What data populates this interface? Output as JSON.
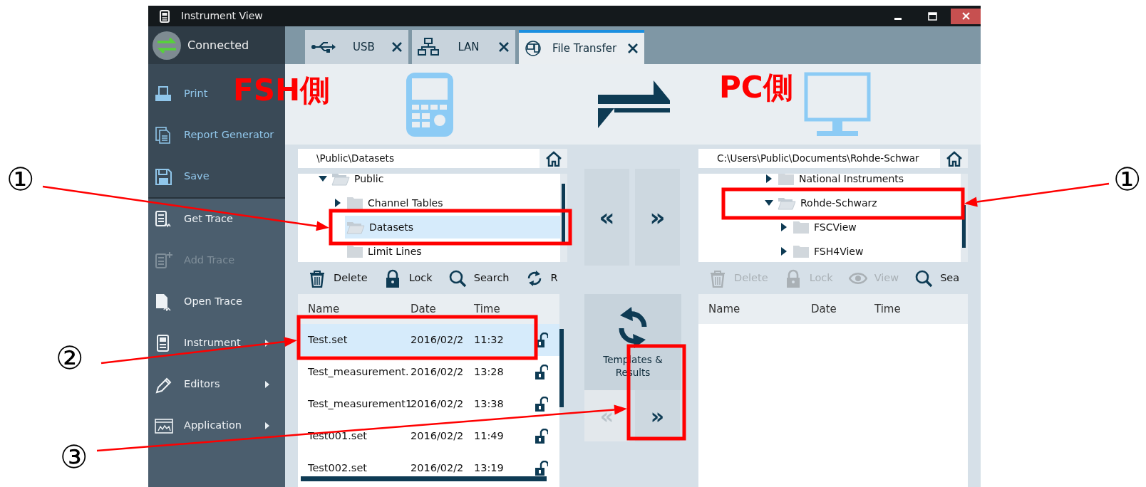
{
  "window": {
    "title": "Instrument View"
  },
  "sidebar": {
    "status": "Connected",
    "sections": [
      {
        "kind": "output",
        "items": [
          {
            "label": "Print",
            "disabled": false,
            "submenu": false
          },
          {
            "label": "Report Generator",
            "disabled": false,
            "submenu": false
          },
          {
            "label": "Save",
            "disabled": false,
            "submenu": false
          }
        ]
      },
      {
        "kind": "trace",
        "items": [
          {
            "label": "Get Trace",
            "disabled": false,
            "submenu": false
          },
          {
            "label": "Add Trace",
            "disabled": true,
            "submenu": false
          },
          {
            "label": "Open Trace",
            "disabled": false,
            "submenu": false
          },
          {
            "label": "Instrument",
            "disabled": false,
            "submenu": true
          },
          {
            "label": "Editors",
            "disabled": false,
            "submenu": true
          },
          {
            "label": "Application",
            "disabled": false,
            "submenu": true
          }
        ]
      }
    ]
  },
  "tabs": [
    {
      "label": "USB",
      "selected": false
    },
    {
      "label": "LAN",
      "selected": false
    },
    {
      "label": "File Transfer",
      "selected": true
    }
  ],
  "panels": [
    {
      "path": "\\Public\\Datasets",
      "tree": [
        {
          "label": "Public",
          "expanded": true,
          "selected": false,
          "children": [
            {
              "label": "Channel Tables",
              "expanded": false,
              "selected": false
            },
            {
              "label": "Datasets",
              "selected": true
            },
            {
              "label": "Limit Lines",
              "selected": false
            }
          ]
        }
      ],
      "toolbar": [
        {
          "label": "Delete",
          "disabled": false
        },
        {
          "label": "Lock",
          "disabled": false
        },
        {
          "label": "Search",
          "disabled": false
        },
        {
          "label": "R",
          "disabled": false
        }
      ],
      "columns": [
        "Name",
        "Date",
        "Time"
      ],
      "rows": [
        {
          "name": "Test.set",
          "date": "2016/02/2",
          "time": "11:32",
          "locked": false,
          "selected": true
        },
        {
          "name": "Test_measurement.",
          "date": "2016/02/2",
          "time": "13:28",
          "locked": false,
          "selected": false
        },
        {
          "name": "Test_measurement1",
          "date": "2016/02/2",
          "time": "13:38",
          "locked": false,
          "selected": false
        },
        {
          "name": "Test001.set",
          "date": "2016/02/2",
          "time": "11:49",
          "locked": false,
          "selected": false
        },
        {
          "name": "Test002.set",
          "date": "2016/02/2",
          "time": "13:19",
          "locked": false,
          "selected": false
        }
      ]
    },
    {
      "path": "C:\\Users\\Public\\Documents\\Rohde-Schwar",
      "tree": [
        {
          "label": "National Instruments",
          "expanded": false,
          "selected": false
        },
        {
          "label": "Rohde-Schwarz",
          "expanded": true,
          "selected": false,
          "children": [
            {
              "label": "FSCView",
              "expanded": false,
              "selected": false
            },
            {
              "label": "FSH4View",
              "expanded": false,
              "selected": false
            }
          ]
        }
      ],
      "toolbar": [
        {
          "label": "Delete",
          "disabled": true
        },
        {
          "label": "Lock",
          "disabled": true
        },
        {
          "label": "View",
          "disabled": true
        },
        {
          "label": "Sea",
          "disabled": false
        }
      ],
      "columns": [
        "Name",
        "Date",
        "Time"
      ]
    }
  ],
  "transfer": {
    "top": [
      {
        "label": "«",
        "disabled": false
      },
      {
        "label": "»",
        "disabled": false
      }
    ],
    "templates": {
      "label": "Templates & Results"
    },
    "bottom": [
      {
        "label": "«",
        "disabled": true
      },
      {
        "label": "»",
        "disabled": false
      }
    ]
  },
  "annotations": {
    "labels": [
      "FSH側",
      "PC側"
    ],
    "callouts": [
      "①",
      "②",
      "③",
      "①"
    ]
  }
}
